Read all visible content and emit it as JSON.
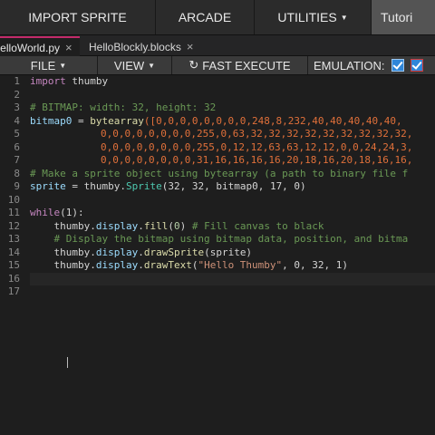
{
  "nav": {
    "import_sprite": "IMPORT SPRITE",
    "arcade": "ARCADE",
    "utilities": "UTILITIES",
    "tutorials": "Tutori"
  },
  "tabs": [
    {
      "label": "HelloWorld.py",
      "close": "×"
    },
    {
      "label": "HelloBlockly.blocks",
      "close": "×"
    }
  ],
  "toolbar": {
    "file": "FILE",
    "view": "VIEW",
    "fast_execute": "FAST EXECUTE",
    "emulation": "EMULATION:"
  },
  "editor": {
    "line_numbers": [
      "1",
      "2",
      "3",
      "4",
      "5",
      "6",
      "7",
      "8",
      "9",
      "10",
      "11",
      "12",
      "13",
      "14",
      "15",
      "16",
      "17"
    ],
    "lines": {
      "l1_kw": "import",
      "l1_rest": " thumby",
      "l3": "# BITMAP: width: 32, height: 32",
      "l4_var": "bitmap0",
      "l4_eq": " = ",
      "l4_fn": "bytearray",
      "l4_nums": "([0,0,0,0,0,0,0,0,248,8,232,40,40,40,40,40,",
      "l5": "0,0,0,0,0,0,0,0,255,0,63,32,32,32,32,32,32,32,32,32,",
      "l6": "0,0,0,0,0,0,0,0,255,0,12,12,63,63,12,12,0,0,24,24,3,",
      "l7": "0,0,0,0,0,0,0,0,31,16,16,16,16,20,18,16,20,18,16,16,",
      "l8": "# Make a sprite object using bytearray (a path to binary file f",
      "l9_var": "sprite",
      "l9_eq": " = thumby.",
      "l9_cls": "Sprite",
      "l9_args": "(32, 32, bitmap0, 17, 0)",
      "l11_kw": "while",
      "l11_rest": "(1):",
      "l12_a": "    thumby.",
      "l12_b": "display",
      "l12_c": ".",
      "l12_fn": "fill",
      "l12_d": "(",
      "l12_num": "0",
      "l12_e": ") ",
      "l12_cm": "# Fill canvas to black",
      "l13": "    # Display the bitmap using bitmap data, position, and bitma",
      "l14_a": "    thumby.",
      "l14_b": "display",
      "l14_c": ".",
      "l14_fn": "drawSprite",
      "l14_d": "(sprite)",
      "l15_a": "    thumby.",
      "l15_b": "display",
      "l15_c": ".",
      "l15_fn": "drawText",
      "l15_d": "(",
      "l15_str": "\"Hello Thumby\"",
      "l15_e": ", 0, 32, 1)"
    }
  }
}
